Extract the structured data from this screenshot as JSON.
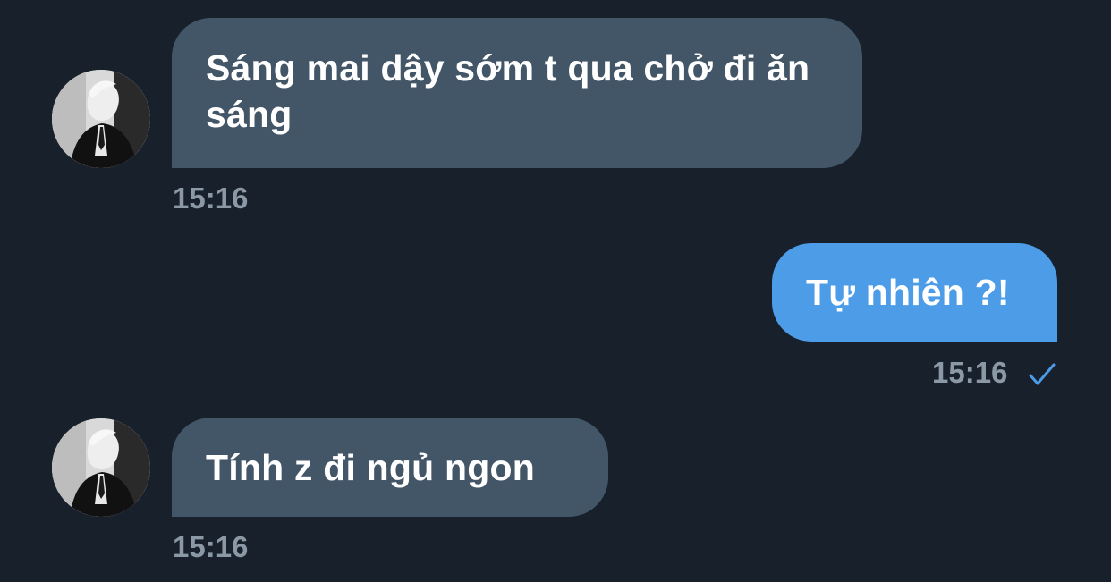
{
  "chat": {
    "messages": [
      {
        "direction": "incoming",
        "text": "Sáng mai dậy sớm t qua chở đi ăn sáng",
        "time": "15:16",
        "avatar_icon": "avatar-photo"
      },
      {
        "direction": "outgoing",
        "text": "Tự nhiên ?!",
        "time": "15:16",
        "status_icon": "check-icon"
      },
      {
        "direction": "incoming",
        "text": "Tính z đi ngủ ngon",
        "time": "15:16",
        "avatar_icon": "avatar-photo"
      }
    ]
  },
  "colors": {
    "background": "#18202b",
    "incoming_bubble": "#435668",
    "outgoing_bubble": "#4c9ce8",
    "timestamp": "#8b98a5",
    "check": "#4c9ce8"
  }
}
